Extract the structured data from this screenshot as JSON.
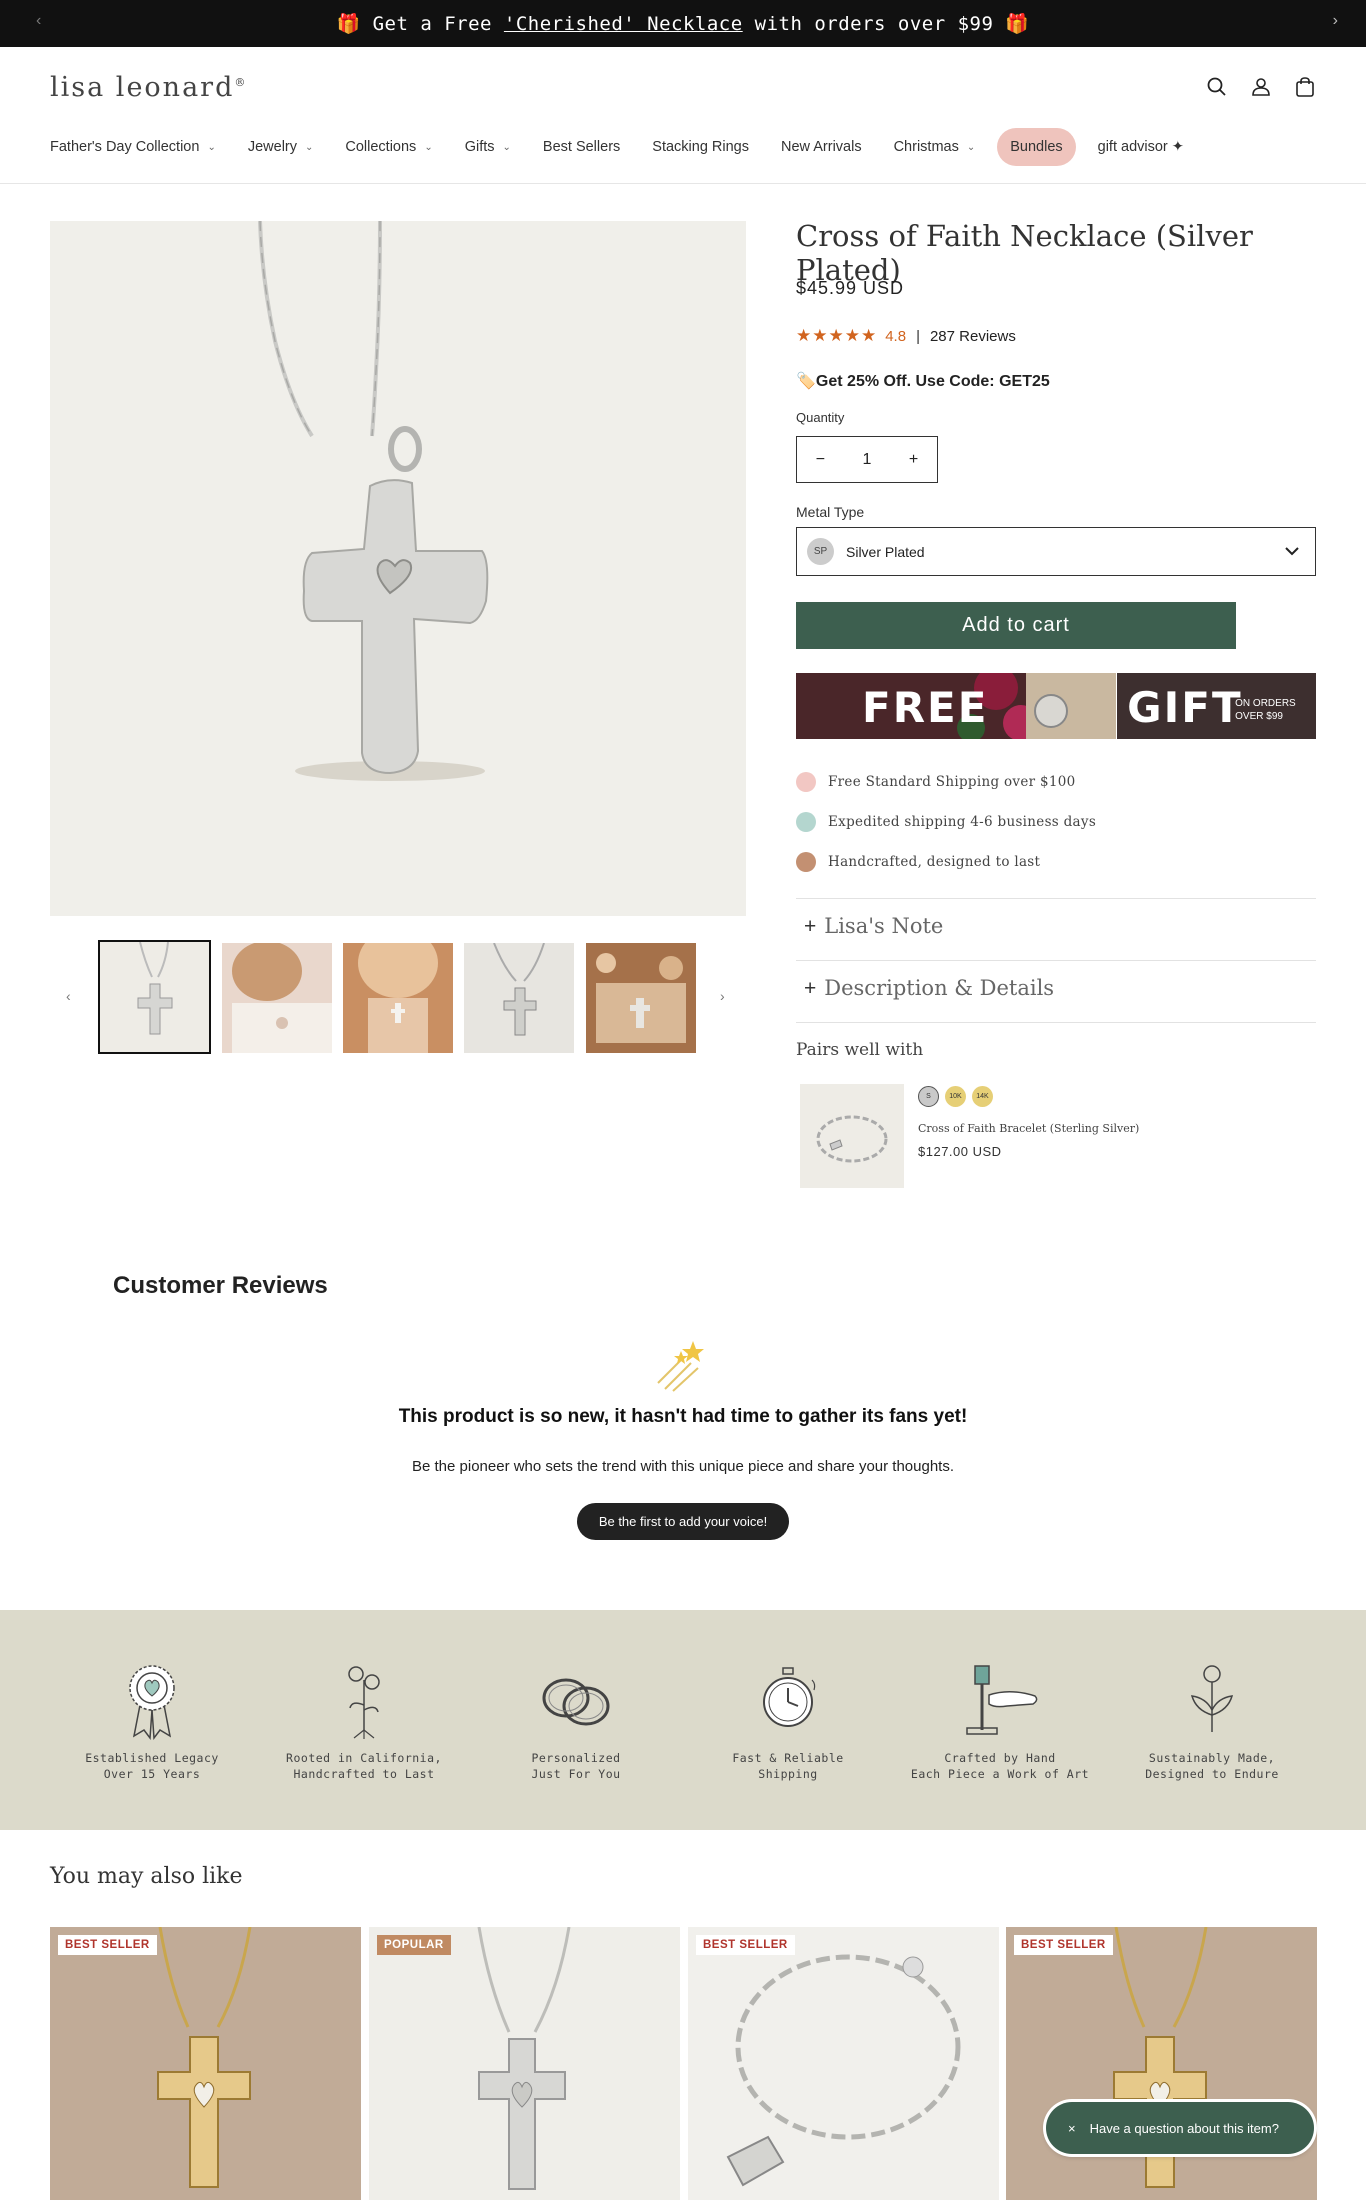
{
  "announcement": {
    "prefix": "🎁 Get a Free ",
    "link": "'Cherished' Necklace",
    "suffix": " with orders over $99 🎁",
    "prev": "‹",
    "next": "›"
  },
  "header": {
    "logo": "lisa leonard",
    "logo_mark": "®",
    "icons": [
      "search-icon",
      "account-icon",
      "cart-icon"
    ]
  },
  "nav": [
    {
      "label": "Father's Day Collection",
      "dropdown": true
    },
    {
      "label": "Jewelry",
      "dropdown": true
    },
    {
      "label": "Collections",
      "dropdown": true
    },
    {
      "label": "Gifts",
      "dropdown": true
    },
    {
      "label": "Best Sellers",
      "dropdown": false
    },
    {
      "label": "Stacking Rings",
      "dropdown": false
    },
    {
      "label": "New Arrivals",
      "dropdown": false
    },
    {
      "label": "Christmas",
      "dropdown": true
    },
    {
      "label": "Bundles",
      "dropdown": false
    },
    {
      "label": "gift advisor ✦",
      "dropdown": false
    }
  ],
  "product": {
    "title": "Cross of Faith Necklace (Silver Plated)",
    "price": "$45.99 USD",
    "stars": "★★★★★",
    "rating": "4.8",
    "separator": "|",
    "reviews": "287 Reviews",
    "promo": "🏷️Get 25% Off. Use Code: GET25",
    "quantity_label": "Quantity",
    "quantity": "1",
    "minus": "−",
    "plus": "+",
    "metal_label": "Metal Type",
    "metal_badge": "SP",
    "metal_value": "Silver Plated",
    "add_to_cart": "Add to cart"
  },
  "gift_banner": {
    "free": "FREE",
    "gift": "GIFT",
    "on_orders_1": "ON ORDERS",
    "on_orders_2": "OVER $99"
  },
  "features": [
    {
      "text": "Free Standard Shipping over $100",
      "color": "#e7a4a0"
    },
    {
      "text": "Expedited shipping 4-6 business days",
      "color": "#9dc6be"
    },
    {
      "text": "Handcrafted, designed to last",
      "color": "#b07a55"
    }
  ],
  "accordions": [
    {
      "toggle": "+",
      "label": "Lisa's Note"
    },
    {
      "toggle": "+",
      "label": "Description & Details"
    }
  ],
  "pairs": {
    "heading": "Pairs well with",
    "swatches": [
      "S",
      "10K",
      "14K"
    ],
    "name": "Cross of Faith Bracelet (Sterling Silver)",
    "price": "$127.00 USD"
  },
  "reviews": {
    "title": "Customer Reviews",
    "headline": "This product is so new, it hasn't had time to gather its fans yet!",
    "sub": "Be the pioneer who sets the trend with this unique piece and share your thoughts.",
    "button": "Be the first to add your voice!"
  },
  "values": [
    {
      "icon": "ribbon-heart-icon",
      "line1": "Established Legacy",
      "line2": "Over 15 Years"
    },
    {
      "icon": "flower-roots-icon",
      "line1": "Rooted in California,",
      "line2": "Handcrafted to Last"
    },
    {
      "icon": "rings-icon",
      "line1": "Personalized",
      "line2": "Just For You"
    },
    {
      "icon": "stopwatch-icon",
      "line1": "Fast & Reliable",
      "line2": "Shipping"
    },
    {
      "icon": "hammer-hand-icon",
      "line1": "Crafted by Hand",
      "line2": "Each Piece a Work of Art"
    },
    {
      "icon": "sprout-icon",
      "line1": "Sustainably Made,",
      "line2": "Designed to Endure"
    }
  ],
  "also_like": {
    "heading": "You may also like",
    "cards": [
      {
        "badge": "BEST SELLER",
        "kind": "gold-cross"
      },
      {
        "badge": "POPULAR",
        "kind": "silver-cross"
      },
      {
        "badge": "BEST SELLER",
        "kind": "bracelet"
      },
      {
        "badge": "BEST SELLER",
        "kind": "gold-cross"
      }
    ]
  },
  "chat": {
    "close": "×",
    "label": "Have a question about this item?"
  },
  "colors": {
    "accent_green": "#3d5f4f",
    "star_orange": "#d1641f",
    "bundles_pink": "#efc4bd",
    "band_beige": "#dcdacb"
  }
}
